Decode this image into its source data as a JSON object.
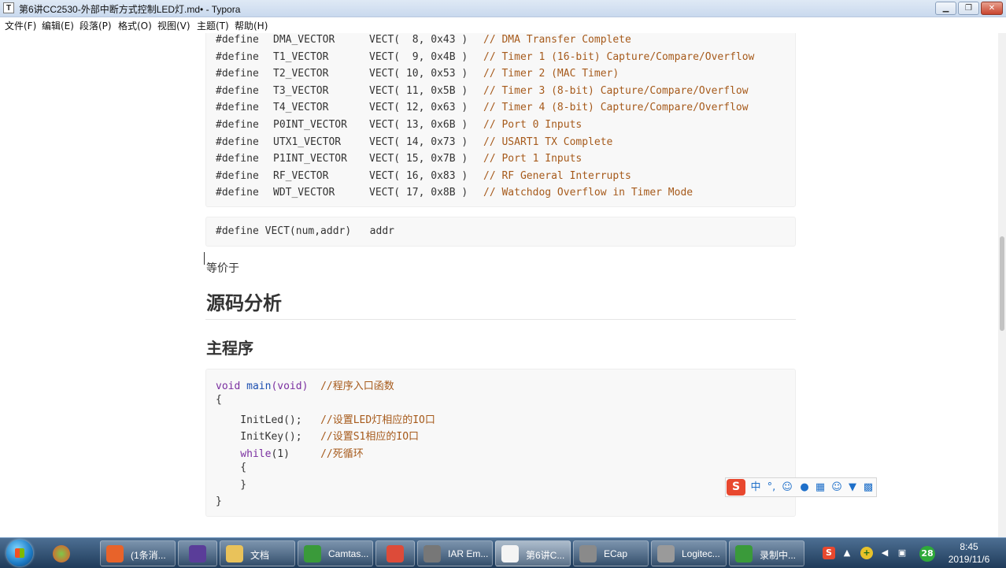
{
  "window": {
    "app_icon": "T",
    "title": "第6讲CC2530-外部中断方式控制LED灯.md• - Typora",
    "minimize_icon": "minimize-icon",
    "maximize_icon": "maximize-icon",
    "close_icon": "close-icon"
  },
  "menu": [
    {
      "label": "文件(F)"
    },
    {
      "label": "编辑(E)"
    },
    {
      "label": "段落(P)"
    },
    {
      "label": "格式(O)"
    },
    {
      "label": "视图(V)"
    },
    {
      "label": "主题(T)"
    },
    {
      "label": "帮助(H)"
    }
  ],
  "vector_defines": [
    {
      "name": "DMA_VECTOR",
      "vect": "VECT(  8, 0x43 )",
      "comment": "// DMA Transfer Complete"
    },
    {
      "name": "T1_VECTOR",
      "vect": "VECT(  9, 0x4B )",
      "comment": "// Timer 1 (16-bit) Capture/Compare/Overflow"
    },
    {
      "name": "T2_VECTOR",
      "vect": "VECT( 10, 0x53 )",
      "comment": "// Timer 2 (MAC Timer)"
    },
    {
      "name": "T3_VECTOR",
      "vect": "VECT( 11, 0x5B )",
      "comment": "// Timer 3 (8-bit) Capture/Compare/Overflow"
    },
    {
      "name": "T4_VECTOR",
      "vect": "VECT( 12, 0x63 )",
      "comment": "// Timer 4 (8-bit) Capture/Compare/Overflow"
    },
    {
      "name": "P0INT_VECTOR",
      "vect": "VECT( 13, 0x6B )",
      "comment": "// Port 0 Inputs"
    },
    {
      "name": "UTX1_VECTOR",
      "vect": "VECT( 14, 0x73 )",
      "comment": "// USART1 TX Complete"
    },
    {
      "name": "P1INT_VECTOR",
      "vect": "VECT( 15, 0x7B )",
      "comment": "// Port 1 Inputs"
    },
    {
      "name": "RF_VECTOR",
      "vect": "VECT( 16, 0x83 )",
      "comment": "// RF General Interrupts"
    },
    {
      "name": "WDT_VECTOR",
      "vect": "VECT( 17, 0x8B )",
      "comment": "// Watchdog Overflow in Timer Mode"
    }
  ],
  "define_keyword": "#define",
  "vect_macro_line": "#define VECT(num,addr)   addr",
  "equiv_text": "等价于",
  "heading_source": "源码分析",
  "heading_main": "主程序",
  "main_code": {
    "l1_code": "void",
    "l1_fn": "main",
    "l1_rest": "(void)  ",
    "l1_comment": "//程序入口函数",
    "l2": "{",
    "l3_code": "    InitLed();   ",
    "l3_comment": "//设置LED灯相应的IO口",
    "l4_code": "    InitKey();   ",
    "l4_comment": "//设置S1相应的IO口",
    "l5_kw": "    while",
    "l5_rest": "(1)     ",
    "l5_comment": "//死循环",
    "l6": "    {",
    "l7": "    }",
    "l8": "}"
  },
  "ime": {
    "logo": "S",
    "items": [
      "中",
      "°,",
      "☺",
      "mic-icon",
      "keyboard-icon",
      "user-icon",
      "shirt-icon",
      "grid-icon"
    ]
  },
  "taskbar": {
    "items": [
      {
        "label": "(1条消...",
        "icon": "firefox-icon",
        "color": "#e8632a"
      },
      {
        "label": "",
        "icon": "visual-studio-icon",
        "color": "#5a3d99"
      },
      {
        "label": "文档",
        "icon": "folder-icon",
        "color": "#e9c25a"
      },
      {
        "label": "Camtas...",
        "icon": "camtasia-icon",
        "color": "#3a9a3a"
      },
      {
        "label": "",
        "icon": "chrome-icon",
        "color": "#dd4b39"
      },
      {
        "label": "IAR Em...",
        "icon": "iar-icon",
        "color": "#777777"
      },
      {
        "label": "第6讲C...",
        "icon": "typora-icon",
        "color": "#f4f4f4"
      },
      {
        "label": "ECap",
        "icon": "webcam-icon",
        "color": "#8a8a8a"
      },
      {
        "label": "Logitec...",
        "icon": "logitech-icon",
        "color": "#9a9a9a"
      },
      {
        "label": "录制中...",
        "icon": "recording-icon",
        "color": "#3a9a3a"
      }
    ],
    "tray": {
      "ime_badge": "S",
      "notification_count": "28"
    },
    "clock": {
      "time": "8:45",
      "date": "2019/11/6"
    }
  }
}
